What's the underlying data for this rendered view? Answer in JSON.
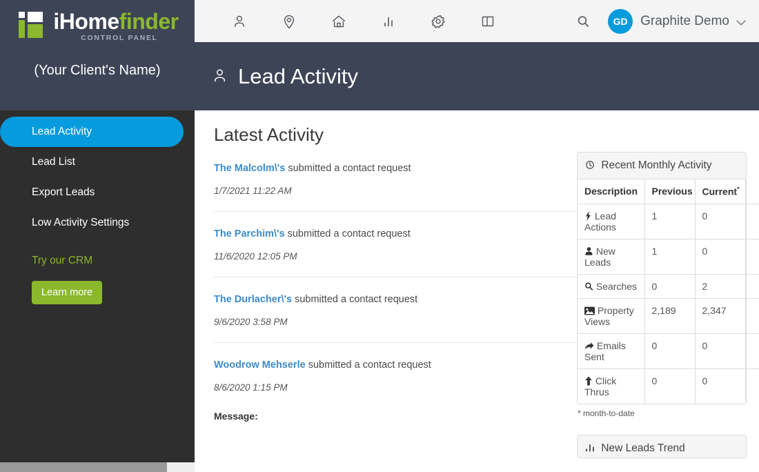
{
  "sidebar": {
    "logo": {
      "mark_icon": "ihomefinder-logo-icon",
      "text_primary": "iHome",
      "text_accent": "finder",
      "subtitle": "CONTROL PANEL"
    },
    "client_name": "(Your Client's Name)",
    "nav_items": [
      {
        "label": "Lead Activity",
        "active": true
      },
      {
        "label": "Lead List",
        "active": false
      },
      {
        "label": "Export Leads",
        "active": false
      },
      {
        "label": "Low Activity Settings",
        "active": false
      }
    ],
    "promo": {
      "heading": "Try our CRM",
      "button_label": "Learn more"
    },
    "colors": {
      "header_bg": "#3d4456",
      "body_bg": "#2e2e2e",
      "active_pill": "#069bdd",
      "accent_green": "#8bb82d"
    }
  },
  "topbar": {
    "icons": [
      {
        "name": "person-icon",
        "label": "Leads"
      },
      {
        "name": "map-pin-icon",
        "label": "Locations"
      },
      {
        "name": "home-icon",
        "label": "Listings"
      },
      {
        "name": "bar-chart-icon",
        "label": "Reports"
      },
      {
        "name": "gear-icon",
        "label": "Settings"
      },
      {
        "name": "panel-layout-icon",
        "label": "Layout"
      }
    ],
    "search_icon": "search-icon",
    "avatar_initials": "GD",
    "account_name": "Graphite Demo",
    "caret_icon": "chevron-down-icon"
  },
  "page": {
    "title": "Lead Activity",
    "title_icon": "person-icon",
    "section_title": "Latest Activity"
  },
  "activity": [
    {
      "name": "The Malcolm\\'s",
      "action": "submitted a contact request",
      "timestamp": "1/7/2021 11:22 AM"
    },
    {
      "name": "The Parchim\\'s",
      "action": "submitted a contact request",
      "timestamp": "11/6/2020 12:05 PM"
    },
    {
      "name": "The Durlacher\\'s",
      "action": "submitted a contact request",
      "timestamp": "9/6/2020 3:58 PM"
    },
    {
      "name": "Woodrow Mehserle",
      "action": "submitted a contact request",
      "timestamp": "8/6/2020 1:15 PM",
      "message_label": "Message:"
    }
  ],
  "monthly_panel": {
    "title": "Recent Monthly Activity",
    "title_icon": "clock-icon",
    "columns": [
      "Description",
      "Previous",
      "Current",
      ""
    ],
    "current_superscript": "*",
    "rows": [
      {
        "icon": "bolt-icon",
        "description": "Lead Actions",
        "previous": "1",
        "current": "0"
      },
      {
        "icon": "user-icon",
        "description": "New Leads",
        "previous": "1",
        "current": "0"
      },
      {
        "icon": "search-icon",
        "description": "Searches",
        "previous": "0",
        "current": "2"
      },
      {
        "icon": "image-icon",
        "description": "Property Views",
        "previous": "2,189",
        "current": "2,347"
      },
      {
        "icon": "share-icon",
        "description": "Emails Sent",
        "previous": "0",
        "current": "0"
      },
      {
        "icon": "up-arrow-icon",
        "description": "Click Thrus",
        "previous": "0",
        "current": "0"
      }
    ],
    "footnote": "* month-to-date"
  },
  "trend_panel": {
    "title": "New Leads Trend",
    "title_icon": "bar-chart-icon"
  }
}
